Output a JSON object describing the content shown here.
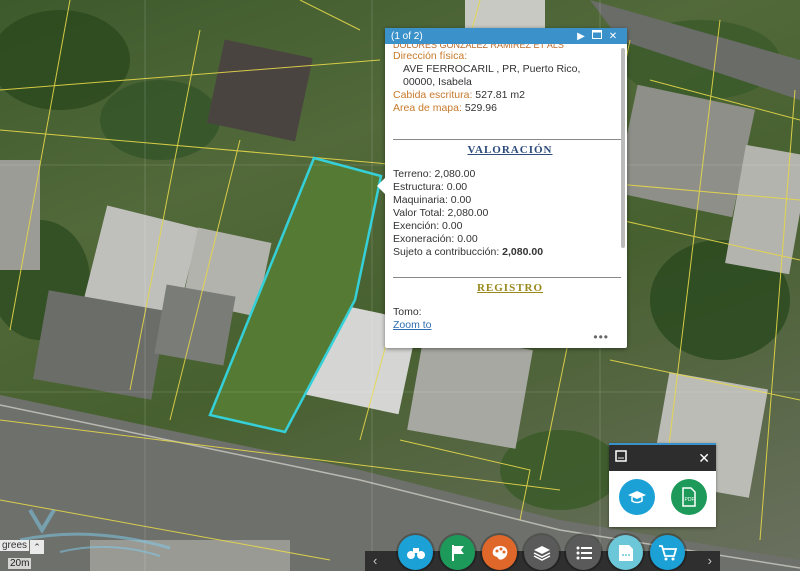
{
  "popup": {
    "count": "(1 of 2)",
    "owner_cut": "DOLORES GONZALEZ RAMIREZ ET ALS",
    "direccion_label": "Dirección física:",
    "direccion_line1": "AVE FERROCARIL , PR, Puerto Rico,",
    "direccion_line2": "00000, Isabela",
    "cabida_label": "Cabida escritura:",
    "cabida_value": "527.81 m2",
    "area_label": "Area de mapa:",
    "area_value": "529.96",
    "valoracion_title": "VALORACIÓN",
    "valores": [
      {
        "label": "Terreno:",
        "value": "2,080.00"
      },
      {
        "label": "Estructura:",
        "value": "0.00"
      },
      {
        "label": "Maquinaria:",
        "value": "0.00"
      },
      {
        "label": "Valor Total:",
        "value": "2,080.00"
      },
      {
        "label": "Exención:",
        "value": "0.00"
      },
      {
        "label": "Exoneración:",
        "value": "0.00"
      }
    ],
    "sujeto_label": "Sujeto a contribucción:",
    "sujeto_value": "2,080.00",
    "registro_title": "REGISTRO",
    "tomo_label": "Tomo:",
    "zoom_label": "Zoom to",
    "more": "•••"
  },
  "header_icons": [
    "play-icon",
    "maximize-icon",
    "close-icon"
  ],
  "widget": {
    "buttons": [
      "mortarboard-icon",
      "pdf-icon"
    ]
  },
  "toolbar": {
    "buttons": [
      {
        "name": "binoculars-icon",
        "color": "#1ba1d6"
      },
      {
        "name": "flag-icon",
        "color": "#1d9a5a"
      },
      {
        "name": "palette-icon",
        "color": "#e0672a"
      },
      {
        "name": "layers-icon",
        "color": "#5a5a5a"
      },
      {
        "name": "list-icon",
        "color": "#5a5a5a"
      },
      {
        "name": "document-icon",
        "color": "#6cc7d9"
      },
      {
        "name": "cart-icon",
        "color": "#1ba1d6"
      }
    ]
  },
  "scale": {
    "degrees": "grees",
    "meters": "20m"
  },
  "colors": {
    "parcel_outline": "#35d0d8",
    "lot_lines": "#e6d84a",
    "popup_header": "#3b91c9"
  }
}
